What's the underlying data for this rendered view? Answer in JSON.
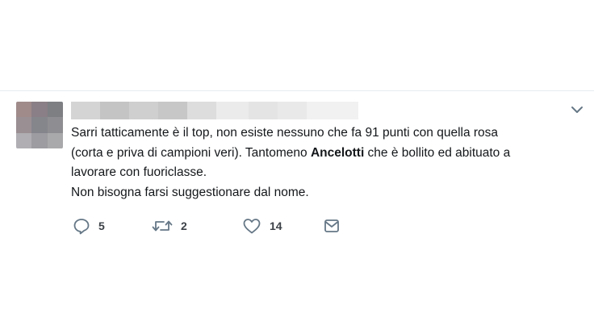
{
  "tweet": {
    "text_lines": [
      "Sarri tatticamente è il top, non esiste nessuno che fa 91 punti con quella rosa",
      "(corta e priva di campioni veri). Tantomeno ",
      "Ancelotti",
      " che è bollito ed abituato a",
      "lavorare con fuoriclasse.",
      "Non bisogna farsi suggestionare dal nome."
    ],
    "author_blurred": true
  },
  "actions": {
    "reply": {
      "icon": "reply-icon",
      "count": "5"
    },
    "retweet": {
      "icon": "retweet-icon",
      "count": "2"
    },
    "like": {
      "icon": "heart-icon",
      "count": "14"
    },
    "message": {
      "icon": "envelope-icon"
    }
  },
  "colors": {
    "icon_gray": "#657786",
    "text": "#14171a",
    "divider": "#e6ecf0"
  }
}
